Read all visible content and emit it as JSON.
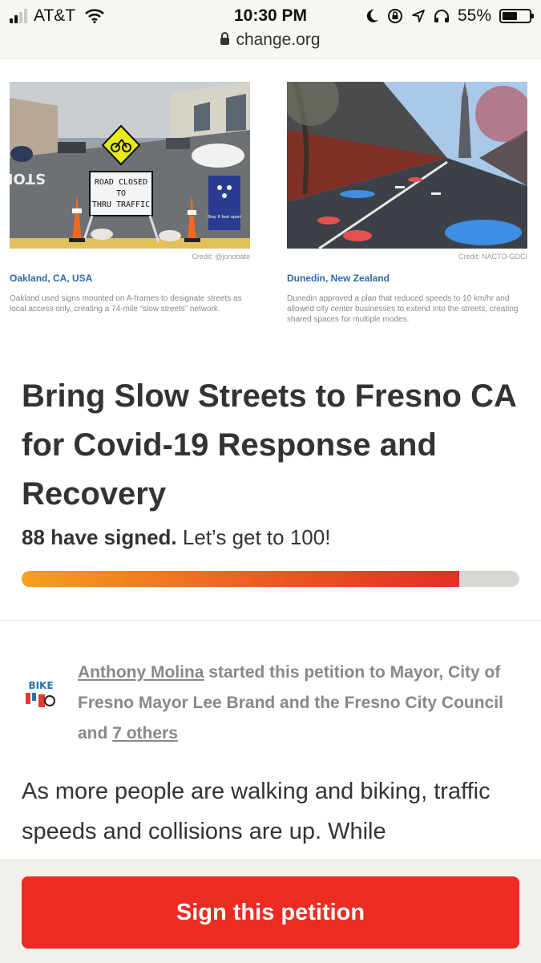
{
  "status_bar": {
    "carrier": "AT&T",
    "time": "10:30 PM",
    "battery": "55%",
    "battery_level": 0.55,
    "url": "change.org"
  },
  "photos": [
    {
      "credit": "Credit: @jonobate",
      "location": "Oakland, CA, USA",
      "description": "Oakland used signs mounted on A-frames to designate streets as local access only, creating a 74-mile “slow streets” network.",
      "sign_text": [
        "ROAD CLOSED",
        "TO",
        "THRU TRAFFIC"
      ],
      "small_sign_text": "STOP",
      "poster_text": "Stay 6 feet apart"
    },
    {
      "credit": "Credit: NACTO-GDCI",
      "location": "Dunedin, New Zealand",
      "description": "Dunedin approved a plan that reduced speeds to 10 km/hr and allowed city center businesses to extend into the streets, creating shared spaces for multiple modes."
    }
  ],
  "petition": {
    "title": "Bring Slow Streets to Fresno CA for Covid-19 Response and Recovery",
    "signed_text": "88 have signed.",
    "goal_text": "Let’s get to 100!",
    "signed_count": 88,
    "goal_count": 100,
    "starter_name": "Anthony Molina",
    "started_text": "started this petition to Mayor, City of Fresno Mayor Lee Brand and the Fresno City Council and",
    "others_link": "7 others",
    "avatar_text": "BIKE",
    "body": "As more people are walking and biking, traffic speeds and collisions are up. While"
  },
  "footer": {
    "sign_button": "Sign this petition"
  },
  "colors": {
    "accent": "#ec2c22",
    "location_blue": "#2c6aa6",
    "progress_start": "#f6a11b",
    "progress_end": "#e52d27"
  }
}
